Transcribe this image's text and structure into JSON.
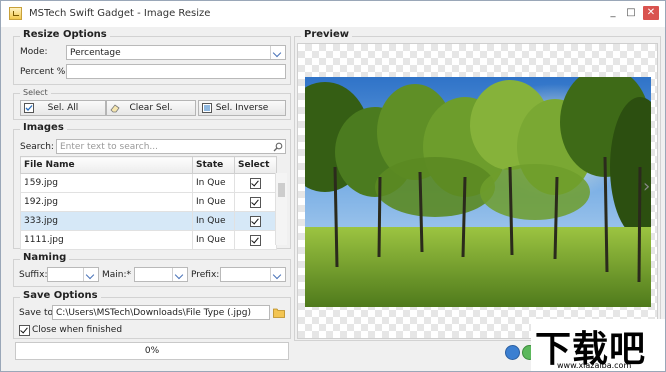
{
  "window": {
    "title": "MSTech Swift Gadget - Image Resize",
    "controls": [
      "_",
      "□",
      "✕"
    ]
  },
  "resize_options": {
    "title": "Resize Options",
    "mode_label": "Mode:",
    "mode_value": "Percentage",
    "percent_label": "Percent %:",
    "percent_value": ""
  },
  "select": {
    "title": "Select",
    "sel_all": "Sel. All",
    "clear_sel": "Clear Sel.",
    "sel_inverse": "Sel. Inverse"
  },
  "images": {
    "title": "Images",
    "search_label": "Search:",
    "search_placeholder": "Enter text to search...",
    "columns": [
      "File Name",
      "State",
      "Select"
    ],
    "rows": [
      {
        "name": "159.jpg",
        "state": "In Que",
        "selected": true
      },
      {
        "name": "192.jpg",
        "state": "In Que",
        "selected": true
      },
      {
        "name": "333.jpg",
        "state": "In Que",
        "selected": true
      },
      {
        "name": "1111.jpg",
        "state": "In Que",
        "selected": true
      }
    ]
  },
  "naming": {
    "title": "Naming",
    "suffix_label": "Suffix:",
    "main_label": "Main:*",
    "prefix_label": "Prefix:"
  },
  "save_options": {
    "title": "Save Options",
    "save_to_label": "Save to:",
    "save_to_value": "C:\\Users\\MSTech\\Downloads\\File Type (.jpg)",
    "close_when_finished": "Close when finished",
    "close_checked": true
  },
  "progress": {
    "text": "0%",
    "value": 0
  },
  "preview": {
    "title": "Preview"
  },
  "watermark": {
    "text": "下载吧",
    "url": "www.xiazaiba.com"
  }
}
